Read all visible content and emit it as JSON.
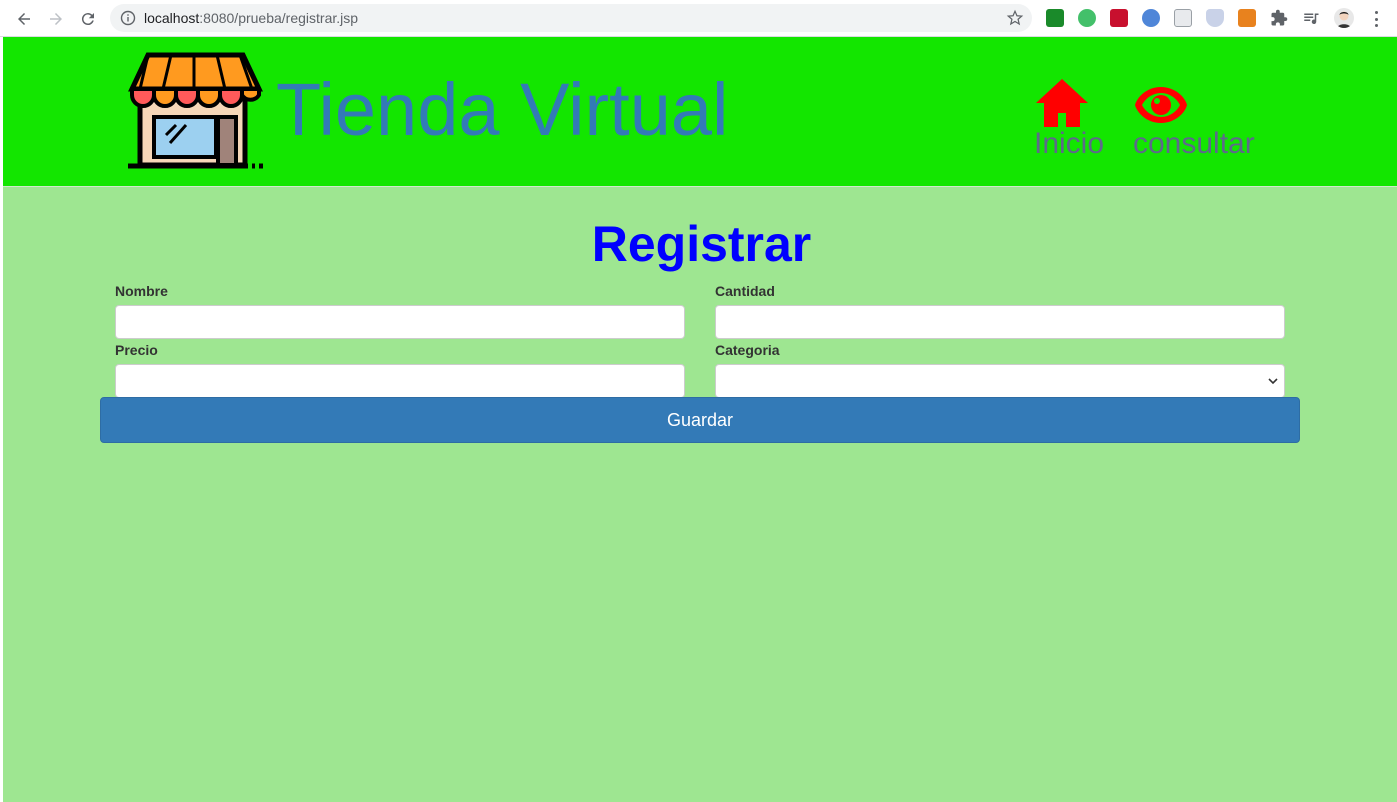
{
  "browser": {
    "url_host": "localhost",
    "url_rest": ":8080/prueba/registrar.jsp",
    "icons": [
      "back-arrow-icon",
      "forward-arrow-icon",
      "reload-icon",
      "info-icon",
      "bookmark-star-icon",
      "extension-icons",
      "puzzle-icon",
      "media-icon",
      "profile-avatar",
      "menu-dots-icon"
    ]
  },
  "header": {
    "brand": "Tienda Virtual",
    "nav": [
      {
        "label": "Inicio",
        "icon": "home-icon"
      },
      {
        "label": "consultar",
        "icon": "eye-icon"
      }
    ],
    "colors": {
      "background": "#13e600",
      "brand_text": "#337ab7",
      "nav_icon": "#ff0000",
      "nav_text": "#5d6a8a"
    }
  },
  "form": {
    "title": "Registrar",
    "fields": {
      "nombre": {
        "label": "Nombre",
        "value": ""
      },
      "cantidad": {
        "label": "Cantidad",
        "value": ""
      },
      "precio": {
        "label": "Precio",
        "value": ""
      },
      "categoria": {
        "label": "Categoria",
        "value": ""
      }
    },
    "submit_label": "Guardar",
    "colors": {
      "page_bg": "#9ee691",
      "title": "#0000ff",
      "button": "#337ab7"
    }
  }
}
